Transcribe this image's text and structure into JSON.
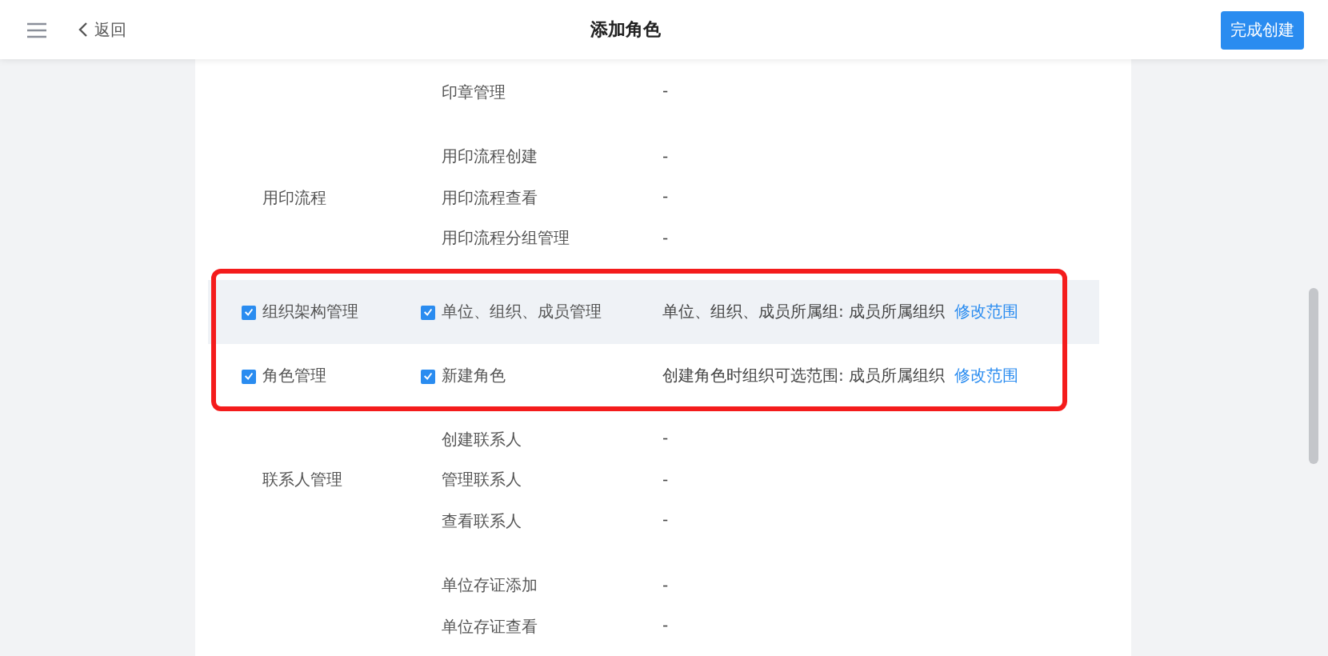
{
  "header": {
    "back": "返回",
    "title": "添加角色",
    "submit": "完成创建"
  },
  "sections": [
    {
      "highlighted": false,
      "groups": [
        {
          "hovered": false,
          "items": [
            {
              "name": "印章管理",
              "scope": "-"
            }
          ]
        },
        {
          "name": "用印流程",
          "hovered": false,
          "items": [
            {
              "name": "用印流程创建",
              "scope": "-"
            },
            {
              "name": "用印流程查看",
              "scope": "-"
            },
            {
              "name": "用印流程分组管理",
              "scope": "-"
            }
          ]
        }
      ]
    },
    {
      "highlighted": true,
      "groups": [
        {
          "name": "组织架构管理",
          "checked": true,
          "hovered": true,
          "items": [
            {
              "name": "单位、组织、成员管理",
              "checked": true,
              "scope": "单位、组织、成员所属组: 成员所属组织",
              "link": "修改范围"
            }
          ]
        },
        {
          "name": "角色管理",
          "checked": true,
          "hovered": false,
          "items": [
            {
              "name": "新建角色",
              "checked": true,
              "scope": "创建角色时组织可选范围: 成员所属组织",
              "link": "修改范围"
            }
          ]
        }
      ]
    },
    {
      "highlighted": false,
      "groups": [
        {
          "name": "联系人管理",
          "hovered": false,
          "items": [
            {
              "name": "创建联系人",
              "scope": "-"
            },
            {
              "name": "管理联系人",
              "scope": "-"
            },
            {
              "name": "查看联系人",
              "scope": "-"
            }
          ]
        },
        {
          "hovered": false,
          "items": [
            {
              "name": "单位存证添加",
              "scope": "-"
            },
            {
              "name": "单位存证查看",
              "scope": "-"
            }
          ]
        }
      ]
    }
  ]
}
